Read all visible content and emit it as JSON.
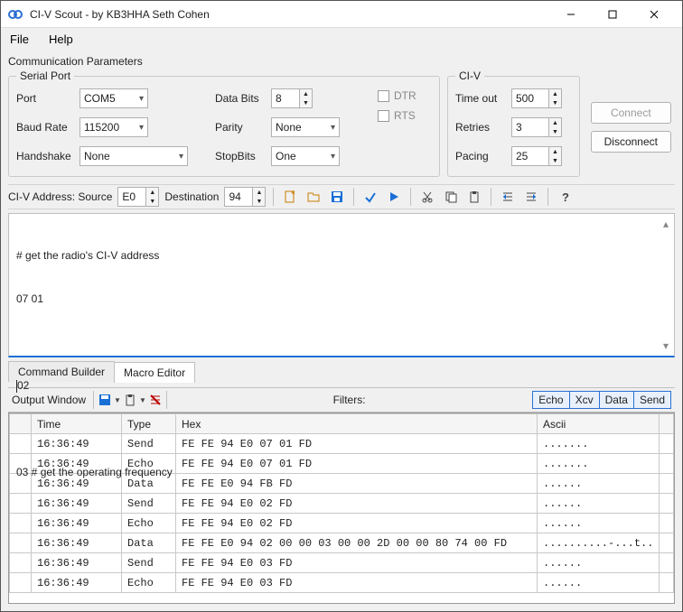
{
  "title": "CI-V Scout - by KB3HHA Seth Cohen",
  "menu": {
    "file": "File",
    "help": "Help"
  },
  "comm_params_label": "Communication Parameters",
  "serial": {
    "legend": "Serial Port",
    "port_label": "Port",
    "port_value": "COM5",
    "baud_label": "Baud Rate",
    "baud_value": "115200",
    "hand_label": "Handshake",
    "hand_value": "None",
    "databits_label": "Data Bits",
    "databits_value": "8",
    "parity_label": "Parity",
    "parity_value": "None",
    "stopbits_label": "StopBits",
    "stopbits_value": "One",
    "dtr_label": "DTR",
    "rts_label": "RTS"
  },
  "civ": {
    "legend": "CI-V",
    "timeout_label": "Time out",
    "timeout_value": "500",
    "retries_label": "Retries",
    "retries_value": "3",
    "pacing_label": "Pacing",
    "pacing_value": "25"
  },
  "connect_label": "Connect",
  "disconnect_label": "Disconnect",
  "addr": {
    "label": "CI-V Address: Source",
    "source": "E0",
    "dest_label": "Destination",
    "dest": "94"
  },
  "editor": {
    "line1": "# get the radio's CI-V address",
    "line2": "07 01",
    "line3_before": "",
    "line3_after": "02",
    "line4": "03 # get the operating frequency"
  },
  "tabs": {
    "builder": "Command Builder",
    "macro": "Macro Editor"
  },
  "output": {
    "label": "Output Window",
    "filters_label": "Filters:",
    "filters": [
      "Echo",
      "Xcv",
      "Data",
      "Send"
    ],
    "headers": {
      "time": "Time",
      "type": "Type",
      "hex": "Hex",
      "ascii": "Ascii"
    },
    "rows": [
      {
        "time": "16:36:49",
        "type": "Send",
        "hex": "FE FE 94 E0 07 01 FD",
        "ascii": "......."
      },
      {
        "time": "16:36:49",
        "type": "Echo",
        "hex": "FE FE 94 E0 07 01 FD",
        "ascii": "......."
      },
      {
        "time": "16:36:49",
        "type": "Data",
        "hex": "FE FE E0 94 FB FD",
        "ascii": "......"
      },
      {
        "time": "16:36:49",
        "type": "Send",
        "hex": "FE FE 94 E0 02 FD",
        "ascii": "......"
      },
      {
        "time": "16:36:49",
        "type": "Echo",
        "hex": "FE FE 94 E0 02 FD",
        "ascii": "......"
      },
      {
        "time": "16:36:49",
        "type": "Data",
        "hex": "FE FE E0 94 02 00 00 03 00 00 2D 00 00 80 74 00 FD",
        "ascii": "..........-...t.."
      },
      {
        "time": "16:36:49",
        "type": "Send",
        "hex": "FE FE 94 E0 03 FD",
        "ascii": "......"
      },
      {
        "time": "16:36:49",
        "type": "Echo",
        "hex": "FE FE 94 E0 03 FD",
        "ascii": "......"
      }
    ]
  }
}
